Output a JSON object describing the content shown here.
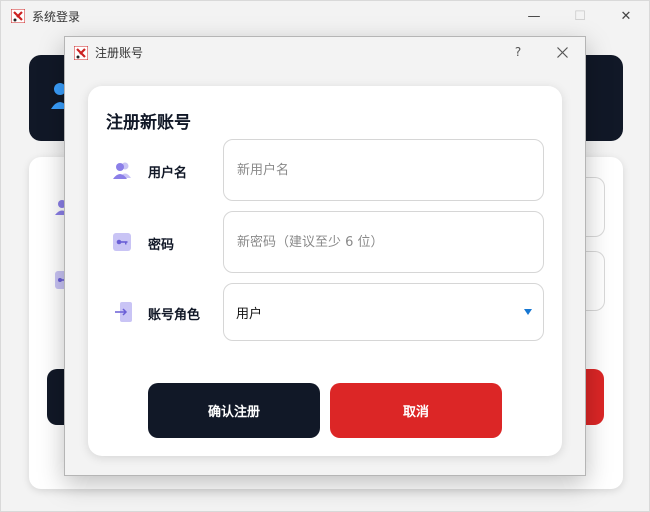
{
  "main_window": {
    "title": "系统登录",
    "controls": {
      "minimize": "—",
      "maximize": "☐",
      "close": "✕"
    }
  },
  "dialog": {
    "title": "注册账号",
    "help": "?",
    "close": "✕",
    "card_title": "注册新账号",
    "fields": {
      "username": {
        "label": "用户名",
        "placeholder": "新用户名",
        "value": ""
      },
      "password": {
        "label": "密码",
        "placeholder": "新密码（建议至少 6 位）",
        "value": ""
      },
      "role": {
        "label": "账号角色",
        "value": "用户"
      }
    },
    "buttons": {
      "confirm": "确认注册",
      "cancel": "取消"
    }
  },
  "colors": {
    "dark": "#111827",
    "red": "#dc2626",
    "icon_purple": "#8b7fe8",
    "accent_blue": "#1677d2"
  },
  "icons": [
    "app-icon",
    "user-group-icon",
    "key-icon",
    "login-arrow-icon",
    "chevron-down-icon",
    "help-icon",
    "close-icon"
  ]
}
